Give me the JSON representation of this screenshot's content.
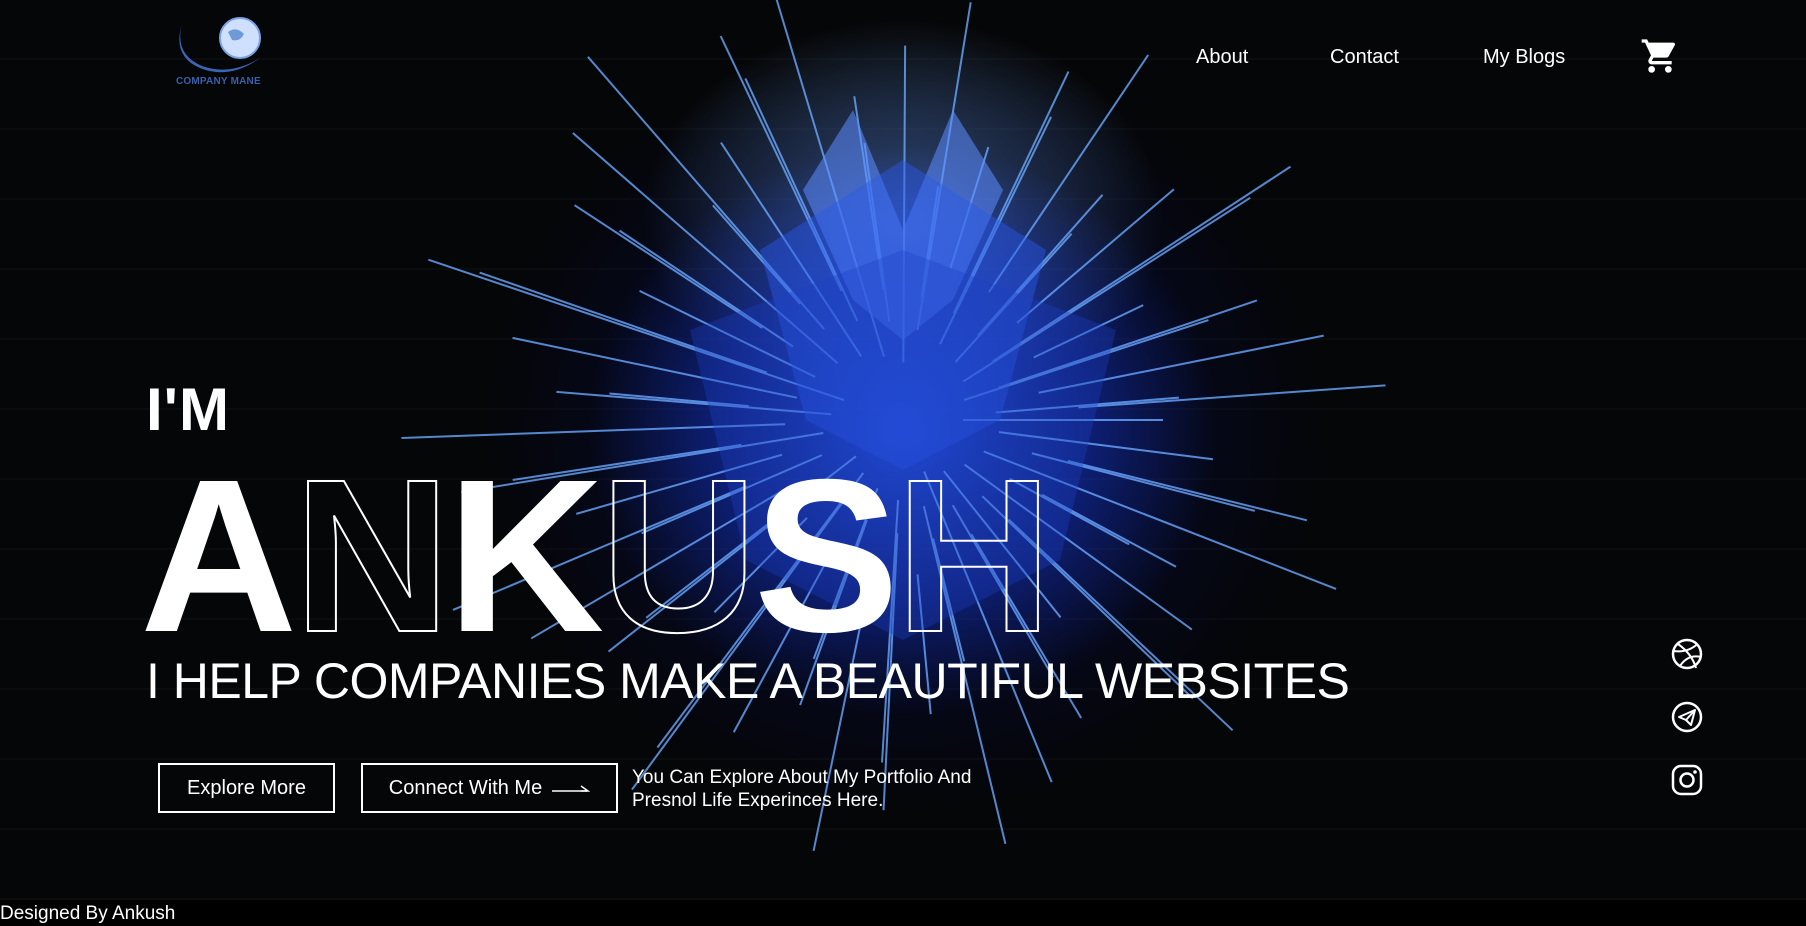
{
  "header": {
    "logo_text": "COMPANY MANE",
    "nav": [
      {
        "label": "About"
      },
      {
        "label": "Contact"
      },
      {
        "label": "My Blogs"
      }
    ],
    "cart_icon": "cart-icon"
  },
  "hero": {
    "intro": "I'M",
    "name_letters": [
      "A",
      "N",
      "K",
      "U",
      "S",
      "H"
    ],
    "tagline": "I HELP COMPANIES MAKE A BEAUTIFUL WEBSITES",
    "explore_label": "Explore More",
    "connect_label": "Connect With Me",
    "blurb": "You Can Explore About My Portfolio And Presnol Life Experinces Here."
  },
  "social": [
    {
      "icon": "dribbble-icon"
    },
    {
      "icon": "telegram-icon"
    },
    {
      "icon": "instagram-icon"
    }
  ],
  "footer": {
    "credit": "Designed By Ankush"
  },
  "colors": {
    "background": "#000000",
    "accent_blue": "#2f5cff",
    "text": "#ffffff",
    "logo_blue": "#3b5fa8"
  }
}
